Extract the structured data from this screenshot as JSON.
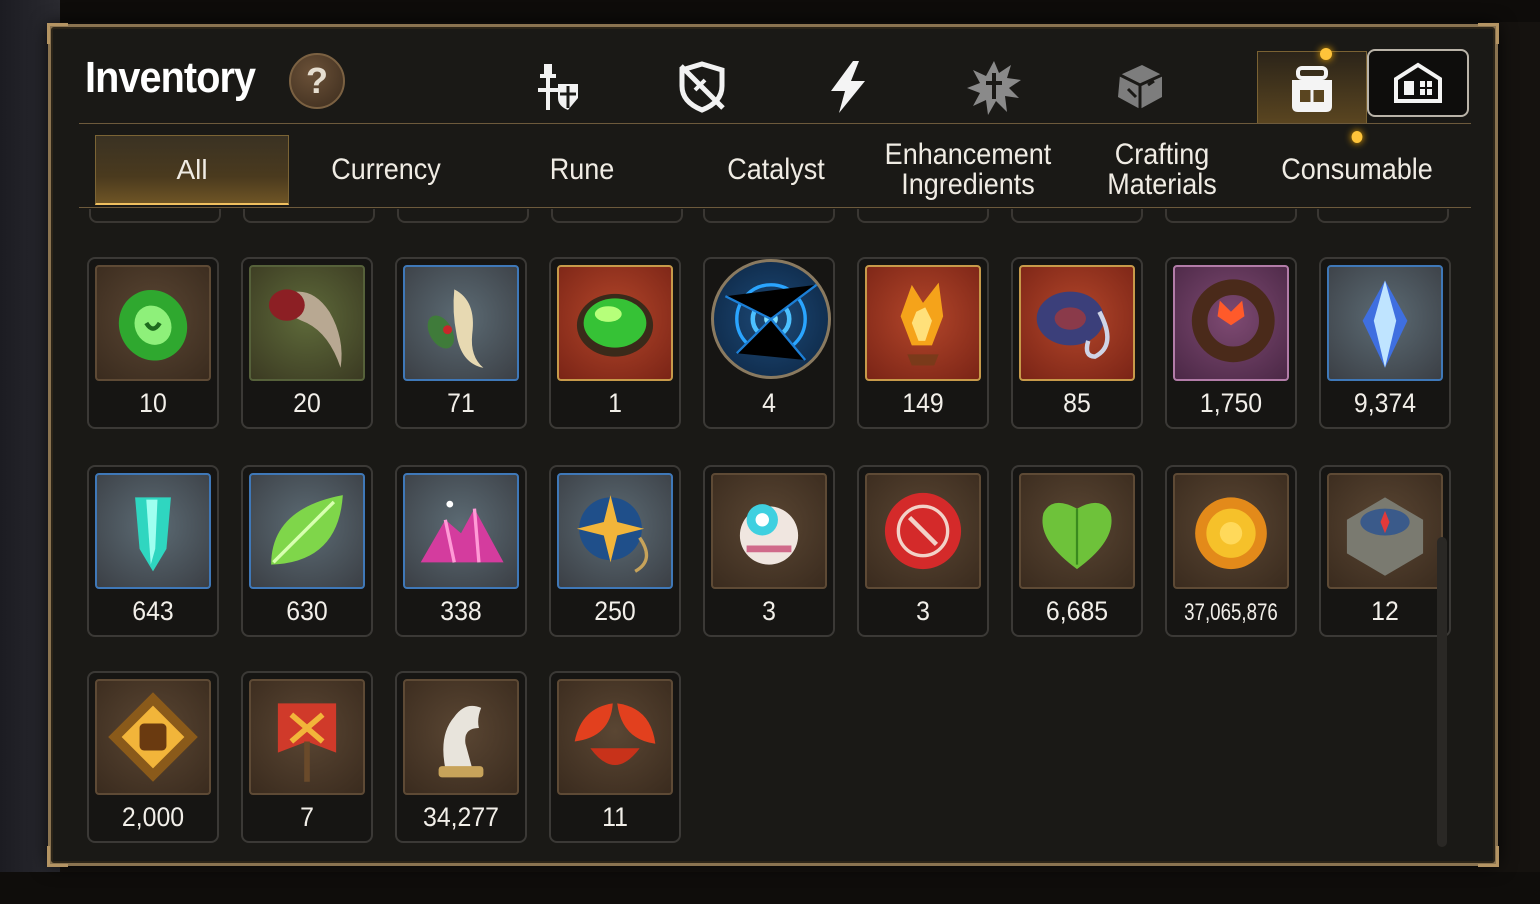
{
  "window": {
    "title": "Inventory",
    "help_label": "?"
  },
  "category_tabs": [
    {
      "name": "gear-tab",
      "icon": "knight-shield-icon",
      "active": false
    },
    {
      "name": "artifact-tab",
      "icon": "crossed-shield-icon",
      "active": false
    },
    {
      "name": "lightning-tab",
      "icon": "lightning-icon",
      "active": false
    },
    {
      "name": "splash-tab",
      "icon": "splash-icon",
      "active": false
    },
    {
      "name": "crate-tab",
      "icon": "crate-icon",
      "active": false
    },
    {
      "name": "backpack-tab",
      "icon": "backpack-icon",
      "active": true
    }
  ],
  "house_button": {
    "icon": "house-icon"
  },
  "filters": [
    {
      "label": "All",
      "active": true
    },
    {
      "label": "Currency"
    },
    {
      "label": "Rune"
    },
    {
      "label": "Catalyst"
    },
    {
      "label": "Enhancement\nIngredients"
    },
    {
      "label": "Crafting\nMaterials"
    },
    {
      "label": "Consumable",
      "notify": true
    }
  ],
  "items": [
    {
      "count": "10",
      "icon": "jade-gem-icon",
      "frame": "brown"
    },
    {
      "count": "20",
      "icon": "claw-icon",
      "frame": "green"
    },
    {
      "count": "71",
      "icon": "root-herb-icon",
      "frame": "blue"
    },
    {
      "count": "1",
      "icon": "green-orb-icon",
      "frame": "red"
    },
    {
      "count": "4",
      "icon": "blue-rune-disc-icon",
      "frame": "round"
    },
    {
      "count": "149",
      "icon": "fire-crystal-icon",
      "frame": "red"
    },
    {
      "count": "85",
      "icon": "coiled-rope-icon",
      "frame": "red"
    },
    {
      "count": "1,750",
      "icon": "flower-ring-icon",
      "frame": "purple"
    },
    {
      "count": "9,374",
      "icon": "blue-crystal-icon",
      "frame": "blue"
    },
    {
      "count": "643",
      "icon": "teal-crystal-icon",
      "frame": "blue"
    },
    {
      "count": "630",
      "icon": "green-leaf-icon",
      "frame": "blue"
    },
    {
      "count": "338",
      "icon": "pink-crystals-icon",
      "frame": "blue"
    },
    {
      "count": "250",
      "icon": "star-charm-icon",
      "frame": "blue"
    },
    {
      "count": "3",
      "icon": "toy-orb-icon",
      "frame": "brown"
    },
    {
      "count": "3",
      "icon": "red-badge-icon",
      "frame": "brown"
    },
    {
      "count": "6,685",
      "icon": "green-heart-icon",
      "frame": "brown"
    },
    {
      "count": "37,065,876",
      "icon": "gold-coin-icon",
      "frame": "brown"
    },
    {
      "count": "12",
      "icon": "compass-stone-icon",
      "frame": "brown"
    },
    {
      "count": "2,000",
      "icon": "fist-emblem-icon",
      "frame": "brown"
    },
    {
      "count": "7",
      "icon": "red-banner-icon",
      "frame": "brown"
    },
    {
      "count": "34,277",
      "icon": "horse-knight-icon",
      "frame": "brown"
    },
    {
      "count": "11",
      "icon": "red-leaf-icon",
      "frame": "brown"
    }
  ],
  "colors": {
    "accent": "#f0c060",
    "frame_border": "#8a7350",
    "notify_dot": "#ffc43a"
  }
}
